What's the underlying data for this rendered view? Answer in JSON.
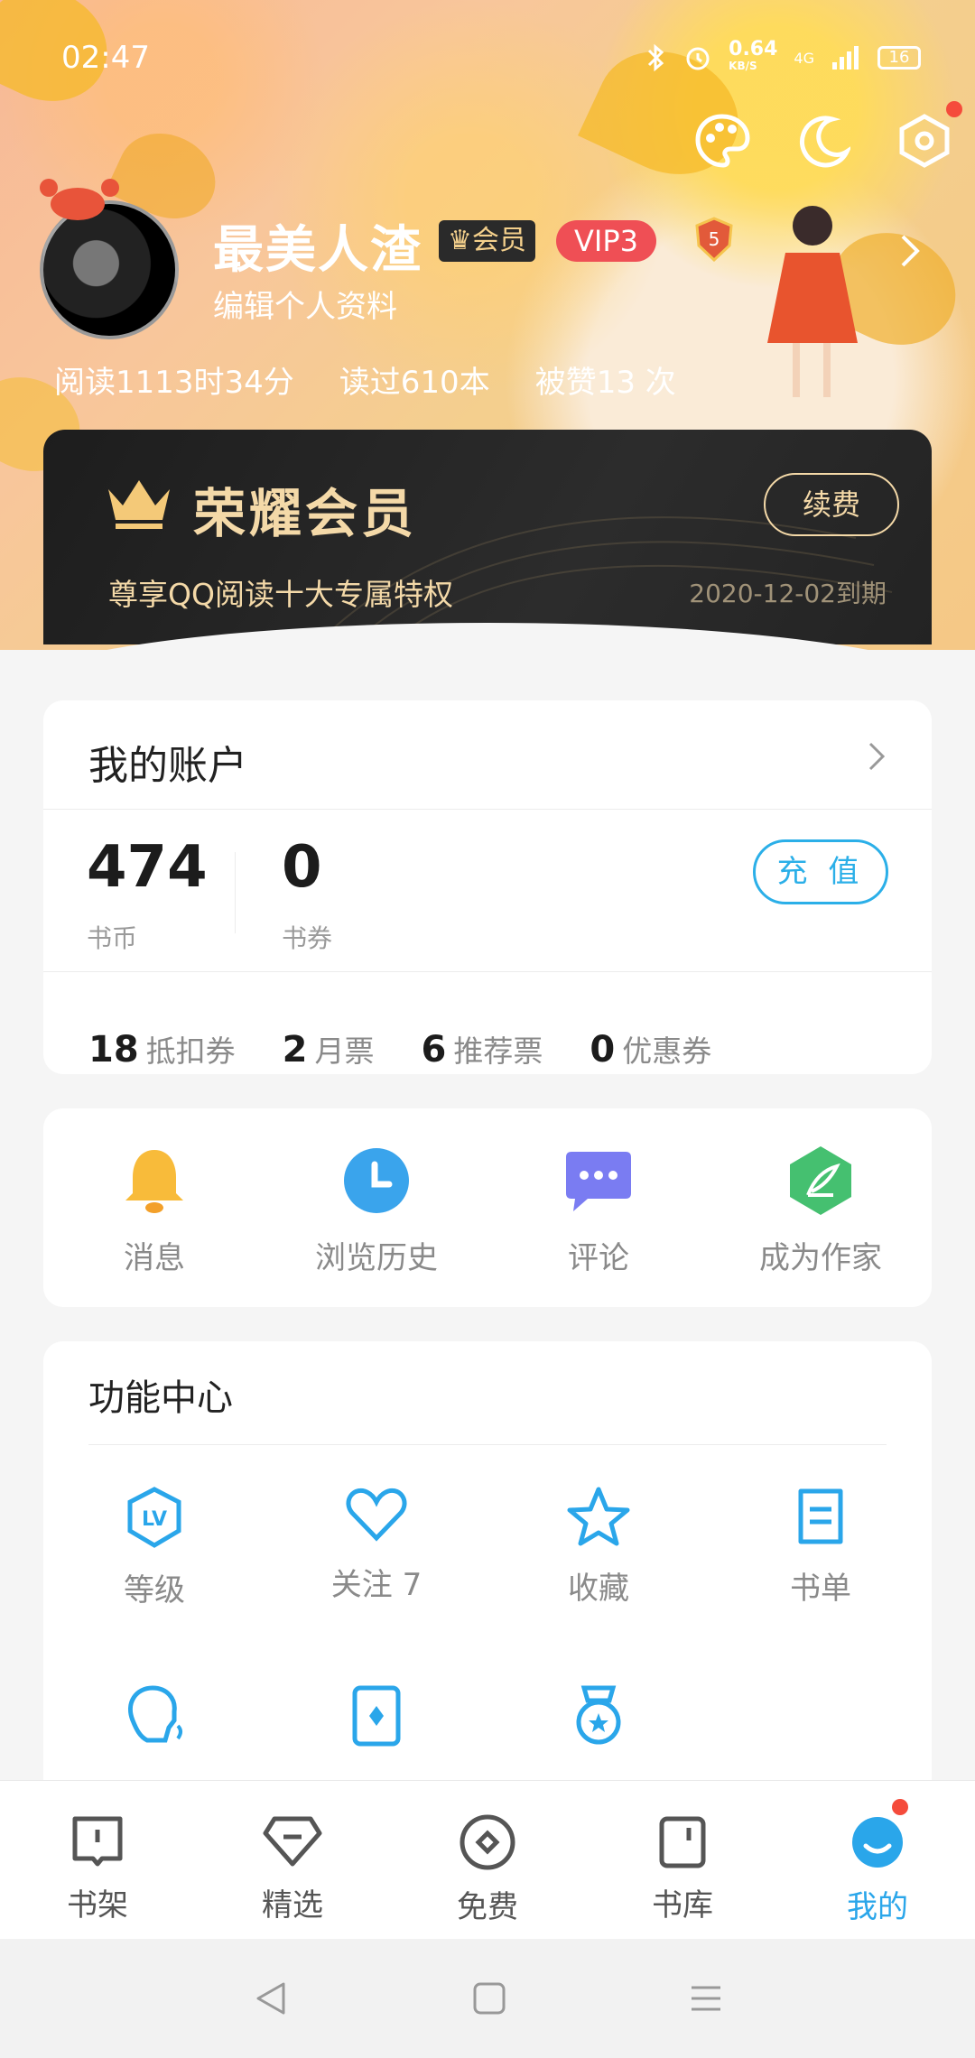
{
  "status_bar": {
    "time": "02:47",
    "net_speed": "0.64",
    "net_unit": "KB/S",
    "network": "4G",
    "battery": "16"
  },
  "profile": {
    "nickname": "最美人渣",
    "member_label": "会员",
    "vip_label": "VIP3",
    "level_badge": "5",
    "edit_label": "编辑个人资料",
    "stats": {
      "read_time": "阅读1113时34分",
      "books_read": "读过610本",
      "likes": "被赞13 次"
    }
  },
  "vip_card": {
    "title": "荣耀会员",
    "renew_label": "续费",
    "desc": "尊享QQ阅读十大专属特权",
    "expiry": "2020-12-02到期"
  },
  "account": {
    "title": "我的账户",
    "coins": {
      "value": "474",
      "label": "书币"
    },
    "vouchers": {
      "value": "0",
      "label": "书券"
    },
    "recharge_label": "充 值",
    "tickets": [
      {
        "count": "18",
        "label": "抵扣券"
      },
      {
        "count": "2",
        "label": "月票"
      },
      {
        "count": "6",
        "label": "推荐票"
      },
      {
        "count": "0",
        "label": "优惠券"
      }
    ]
  },
  "quick_links": [
    {
      "label": "消息",
      "icon": "bell-icon"
    },
    {
      "label": "浏览历史",
      "icon": "clock-icon"
    },
    {
      "label": "评论",
      "icon": "chat-icon"
    },
    {
      "label": "成为作家",
      "icon": "feather-icon"
    }
  ],
  "function_center": {
    "title": "功能中心",
    "items": [
      {
        "label": "等级",
        "icon": "level-icon"
      },
      {
        "label": "关注 7",
        "icon": "heart-icon"
      },
      {
        "label": "收藏",
        "icon": "star-icon"
      },
      {
        "label": "书单",
        "icon": "booklist-icon"
      },
      {
        "label": "",
        "icon": "voice-icon"
      },
      {
        "label": "",
        "icon": "card-icon"
      },
      {
        "label": "",
        "icon": "medal-icon"
      }
    ]
  },
  "tabs": [
    {
      "label": "书架",
      "icon": "bookshelf-icon"
    },
    {
      "label": "精选",
      "icon": "featured-icon"
    },
    {
      "label": "免费",
      "icon": "free-icon"
    },
    {
      "label": "书库",
      "icon": "library-icon"
    },
    {
      "label": "我的",
      "icon": "me-icon",
      "active": true
    }
  ],
  "colors": {
    "accent": "#2aa6ea",
    "vip_red": "#ef4f55",
    "gold": "#f4d9a8"
  }
}
